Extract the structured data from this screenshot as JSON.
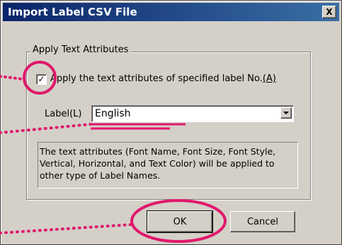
{
  "window": {
    "title": "Import Label CSV File",
    "close_glyph": "X"
  },
  "group": {
    "legend": "Apply Text Attributes",
    "checkbox": {
      "checked": true,
      "check_glyph": "✓",
      "label_prefix": "A",
      "label_rest": "pply the text attributes of specified label No.",
      "label_shortcut": "(A)"
    },
    "label_field": {
      "caption": "Label(L)",
      "value": "English"
    },
    "description": "The text attributes (Font Name, Font Size, Font Style, Vertical, Horizontal, and Text Color) will be applied to other type of Label Names."
  },
  "buttons": {
    "ok": "OK",
    "cancel": "Cancel"
  },
  "annotations": {
    "highlight_color": "#e0186c"
  }
}
